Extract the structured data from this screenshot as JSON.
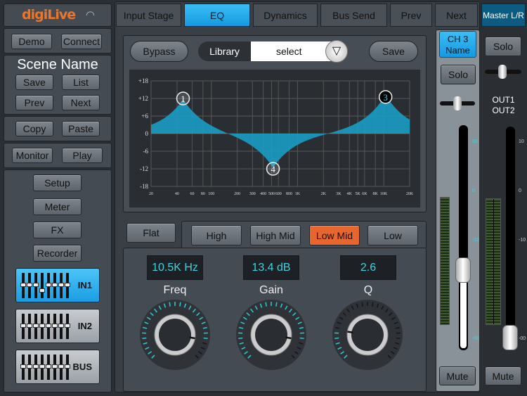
{
  "app": {
    "logo": "digiLive",
    "wifi_icon": "wifi-icon"
  },
  "left": {
    "demo": "Demo",
    "connect": "Connect",
    "scene_name": "Scene Name",
    "save": "Save",
    "list": "List",
    "prev": "Prev",
    "next": "Next",
    "copy": "Copy",
    "paste": "Paste",
    "monitor": "Monitor",
    "play": "Play",
    "setup": "Setup",
    "meter": "Meter",
    "fx": "FX",
    "recorder": "Recorder",
    "layers": [
      {
        "label": "IN1",
        "active": true
      },
      {
        "label": "IN2",
        "active": false
      },
      {
        "label": "BUS",
        "active": false
      }
    ]
  },
  "tabs": [
    {
      "label": "Input Stage",
      "active": false
    },
    {
      "label": "EQ",
      "active": true
    },
    {
      "label": "Dynamics",
      "active": false
    },
    {
      "label": "Bus Send",
      "active": false
    },
    {
      "label": "Prev",
      "active": false
    },
    {
      "label": "Next",
      "active": false
    }
  ],
  "master_tab": "Master L/R",
  "eq": {
    "bypass": "Bypass",
    "library": "Library",
    "select": "select",
    "save": "Save",
    "flat": "Flat",
    "bands": [
      {
        "label": "High",
        "active": false
      },
      {
        "label": "High Mid",
        "active": false
      },
      {
        "label": "Low Mid",
        "active": true
      },
      {
        "label": "Low",
        "active": false
      }
    ],
    "params": {
      "freq_value": "10.5K Hz",
      "gain_value": "13.4 dB",
      "q_value": "2.6",
      "freq_label": "Freq",
      "gain_label": "Gain",
      "q_label": "Q"
    },
    "knob_levels": {
      "freq": 0.87,
      "gain": 0.87,
      "q": 0.2
    },
    "accent": "#e8662e",
    "curve_color": "#1a9cc4"
  },
  "chart_data": {
    "type": "area",
    "x_scale": "log",
    "xlim": [
      20,
      20000
    ],
    "ylim": [
      -18,
      18
    ],
    "grid": true,
    "y_ticks": [
      "+18",
      "+12",
      "+6",
      "0",
      "-6",
      "-12",
      "-18"
    ],
    "x_ticks": [
      {
        "v": 20,
        "l": "20"
      },
      {
        "v": 40,
        "l": "40"
      },
      {
        "v": 60,
        "l": "60"
      },
      {
        "v": 80,
        "l": "80"
      },
      {
        "v": 100,
        "l": "100"
      },
      {
        "v": 200,
        "l": "200"
      },
      {
        "v": 300,
        "l": "300"
      },
      {
        "v": 400,
        "l": "400"
      },
      {
        "v": 500,
        "l": "500"
      },
      {
        "v": 600,
        "l": "600"
      },
      {
        "v": 800,
        "l": "800"
      },
      {
        "v": 1000,
        "l": "1K"
      },
      {
        "v": 2000,
        "l": "2K"
      },
      {
        "v": 3000,
        "l": "3K"
      },
      {
        "v": 4000,
        "l": "4K"
      },
      {
        "v": 5000,
        "l": "5K"
      },
      {
        "v": 6000,
        "l": "6K"
      },
      {
        "v": 8000,
        "l": "8K"
      },
      {
        "v": 10000,
        "l": "10K"
      },
      {
        "v": 20000,
        "l": "20K"
      }
    ],
    "nodes": [
      {
        "id": "1",
        "freq": 47,
        "gain": 12,
        "selected": false
      },
      {
        "id": "4",
        "freq": 520,
        "gain": -12,
        "selected": false
      },
      {
        "id": "3",
        "freq": 10500,
        "gain": 13.4,
        "selected": true
      }
    ]
  },
  "channel": {
    "name_line1": "CH 3",
    "name_line2": "Name",
    "solo": "Solo",
    "mute": "Mute",
    "scale": [
      "10",
      "0",
      "-10",
      "-00"
    ],
    "fader_level": 0.375
  },
  "master": {
    "solo": "Solo",
    "out1": "OUT1",
    "out2": "OUT2",
    "mute": "Mute",
    "scale": [
      "10",
      "0",
      "-10",
      "-00"
    ],
    "fader_level": 0.06
  }
}
